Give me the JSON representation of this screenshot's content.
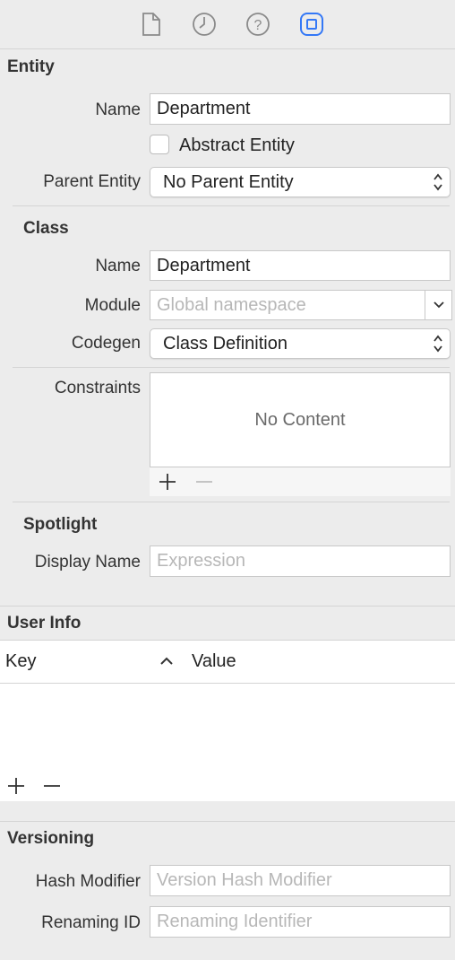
{
  "toolbar": {
    "icons": [
      "file-icon",
      "clock-icon",
      "help-icon",
      "data-model-inspector-icon"
    ],
    "active_color": "#3478f6"
  },
  "entity": {
    "title": "Entity",
    "name_label": "Name",
    "name_value": "Department",
    "abstract_label": "Abstract Entity",
    "abstract_checked": false,
    "parent_label": "Parent Entity",
    "parent_value": "No Parent Entity"
  },
  "class": {
    "title": "Class",
    "name_label": "Name",
    "name_value": "Department",
    "module_label": "Module",
    "module_placeholder": "Global namespace",
    "codegen_label": "Codegen",
    "codegen_value": "Class Definition",
    "constraints_label": "Constraints",
    "constraints_empty": "No Content"
  },
  "spotlight": {
    "title": "Spotlight",
    "display_name_label": "Display Name",
    "display_name_placeholder": "Expression"
  },
  "user_info": {
    "title": "User Info",
    "col_key": "Key",
    "col_value": "Value"
  },
  "versioning": {
    "title": "Versioning",
    "hash_label": "Hash Modifier",
    "hash_placeholder": "Version Hash Modifier",
    "renaming_label": "Renaming ID",
    "renaming_placeholder": "Renaming Identifier"
  }
}
